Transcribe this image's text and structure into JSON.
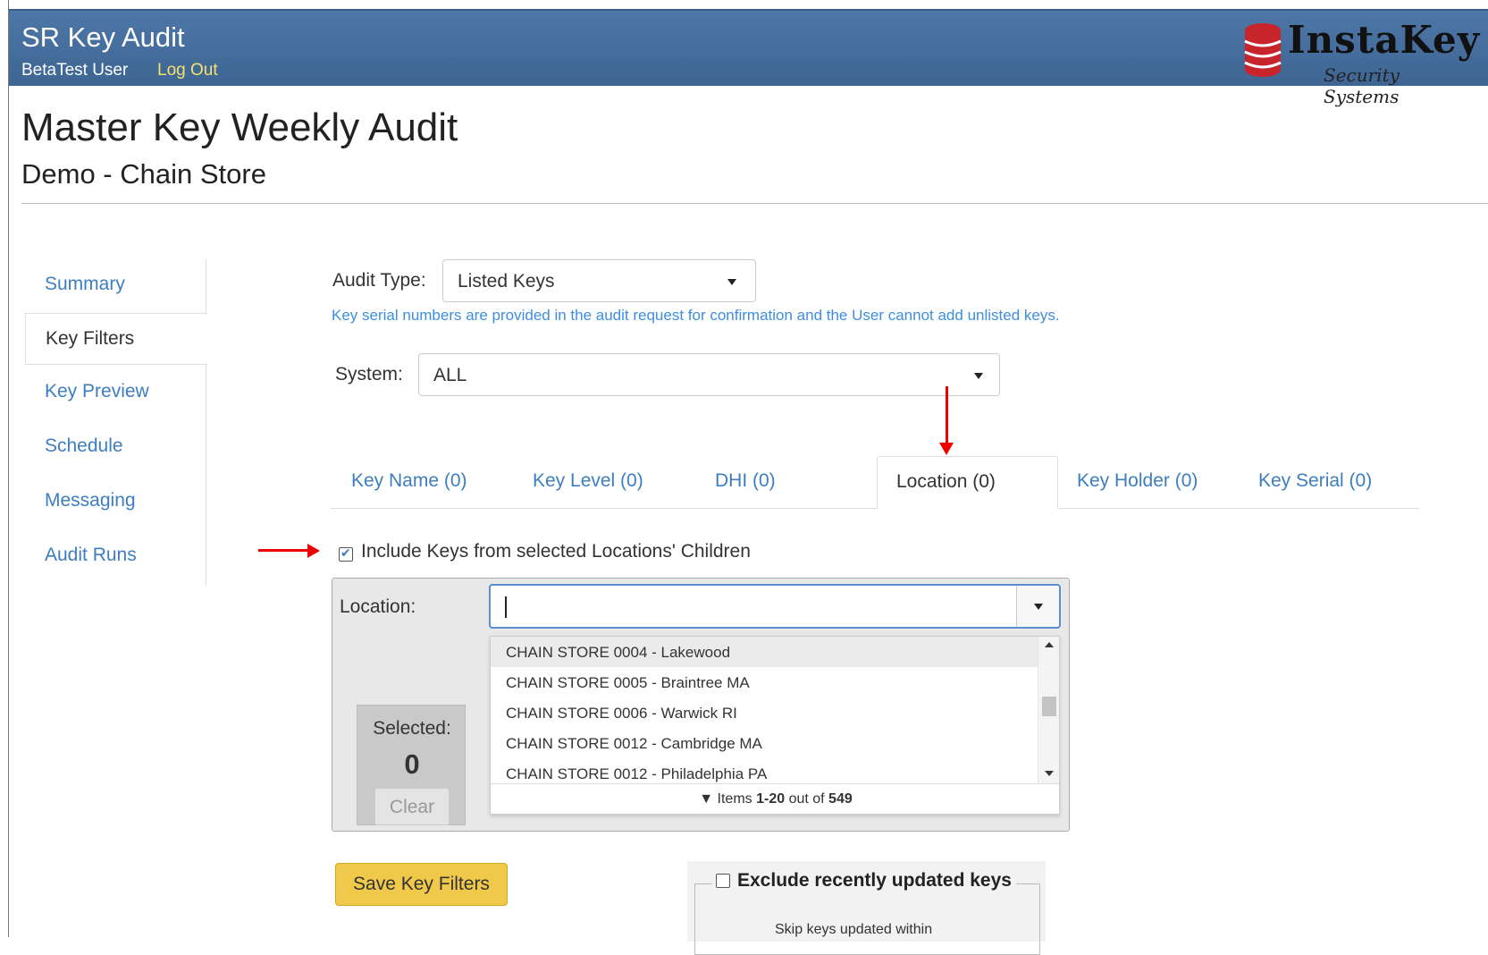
{
  "header": {
    "app_title": "SR Key Audit",
    "user_name": "BetaTest User",
    "logout_label": "Log Out",
    "logo_text": "InstaKey",
    "logo_subtitle": "Security Systems",
    "brand_color": "#3e6593"
  },
  "page": {
    "title": "Master Key Weekly Audit",
    "subtitle": "Demo - Chain Store"
  },
  "sidebar": {
    "items": [
      {
        "label": "Summary",
        "active": false
      },
      {
        "label": "Key Filters",
        "active": true
      },
      {
        "label": "Key Preview",
        "active": false
      },
      {
        "label": "Schedule",
        "active": false
      },
      {
        "label": "Messaging",
        "active": false
      },
      {
        "label": "Audit Runs",
        "active": false
      }
    ]
  },
  "form": {
    "audit_type_label": "Audit Type:",
    "audit_type_value": "Listed Keys",
    "audit_type_hint": "Key serial numbers are provided in the audit request for confirmation and the User cannot add unlisted keys.",
    "system_label": "System:",
    "system_value": "ALL"
  },
  "tabs": [
    {
      "label": "Key Name (0)",
      "active": false
    },
    {
      "label": "Key Level (0)",
      "active": false
    },
    {
      "label": "DHI (0)",
      "active": false
    },
    {
      "label": "Location (0)",
      "active": true
    },
    {
      "label": "Key Holder (0)",
      "active": false
    },
    {
      "label": "Key Serial (0)",
      "active": false
    }
  ],
  "location": {
    "include_children_label": "Include Keys from selected Locations' Children",
    "include_children_checked": true,
    "field_label": "Location:",
    "input_value": "",
    "selected_label": "Selected:",
    "selected_count": "0",
    "clear_label": "Clear",
    "dropdown_items": [
      "CHAIN STORE 0004 - Lakewood",
      "CHAIN STORE 0005 - Braintree MA",
      "CHAIN STORE 0006 - Warwick RI",
      "CHAIN STORE 0012 - Cambridge MA",
      "CHAIN STORE 0012 - Philadelphia PA"
    ],
    "footer_prefix": "Items ",
    "footer_range": "1-20",
    "footer_mid": " out of ",
    "footer_total": "549"
  },
  "actions": {
    "save_label": "Save Key Filters"
  },
  "exclude": {
    "label": "Exclude recently updated keys",
    "checked": false,
    "sub_text": "Skip keys updated within"
  }
}
